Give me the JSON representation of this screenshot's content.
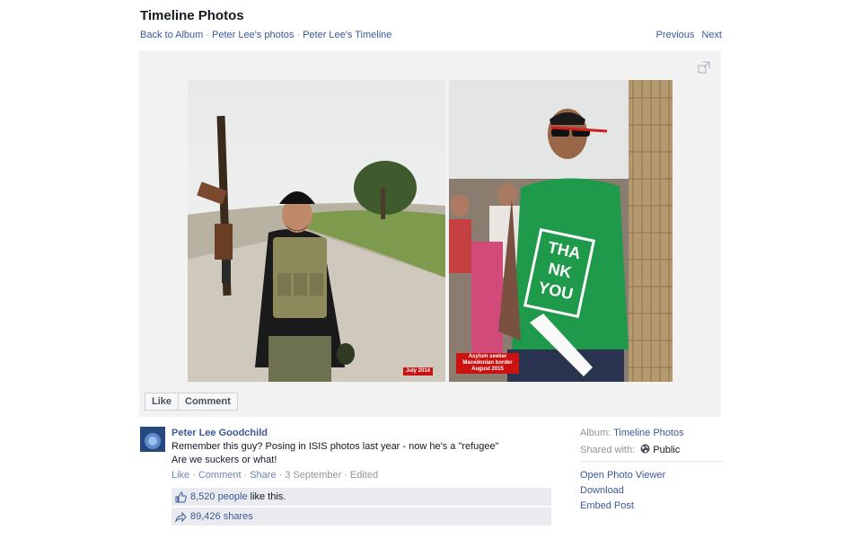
{
  "header": {
    "title": "Timeline Photos",
    "breadcrumbs": [
      "Back to Album",
      "Peter Lee's photos",
      "Peter Lee's Timeline"
    ],
    "previous": "Previous",
    "next": "Next"
  },
  "photo": {
    "caption_left": "July 2014",
    "caption_right_line1": "Asylum seeker",
    "caption_right_line2": "Macedonian border",
    "caption_right_line3": "August 2015",
    "shirt_text": [
      "THA",
      "NK",
      "YOU"
    ]
  },
  "actions": {
    "like": "Like",
    "comment": "Comment"
  },
  "post": {
    "author": "Peter Lee Goodchild",
    "line1": "Remember this guy? Posing in ISIS photos last year - now he's a \"refugee\"",
    "line2": "Are we suckers or what!",
    "meta": {
      "like": "Like",
      "comment": "Comment",
      "share": "Share",
      "date": "3 September",
      "edited": "Edited"
    },
    "likes_count": "8,520 people",
    "likes_suffix": "like this.",
    "shares": "89,426 shares"
  },
  "sidebar": {
    "album_label": "Album:",
    "album_value": "Timeline Photos",
    "shared_label": "Shared with:",
    "shared_value": "Public",
    "links": [
      "Open Photo Viewer",
      "Download",
      "Embed Post"
    ]
  },
  "colors": {
    "link": "#3b5998",
    "caption": "#cc1111",
    "shirt": "#1f9a4a"
  }
}
